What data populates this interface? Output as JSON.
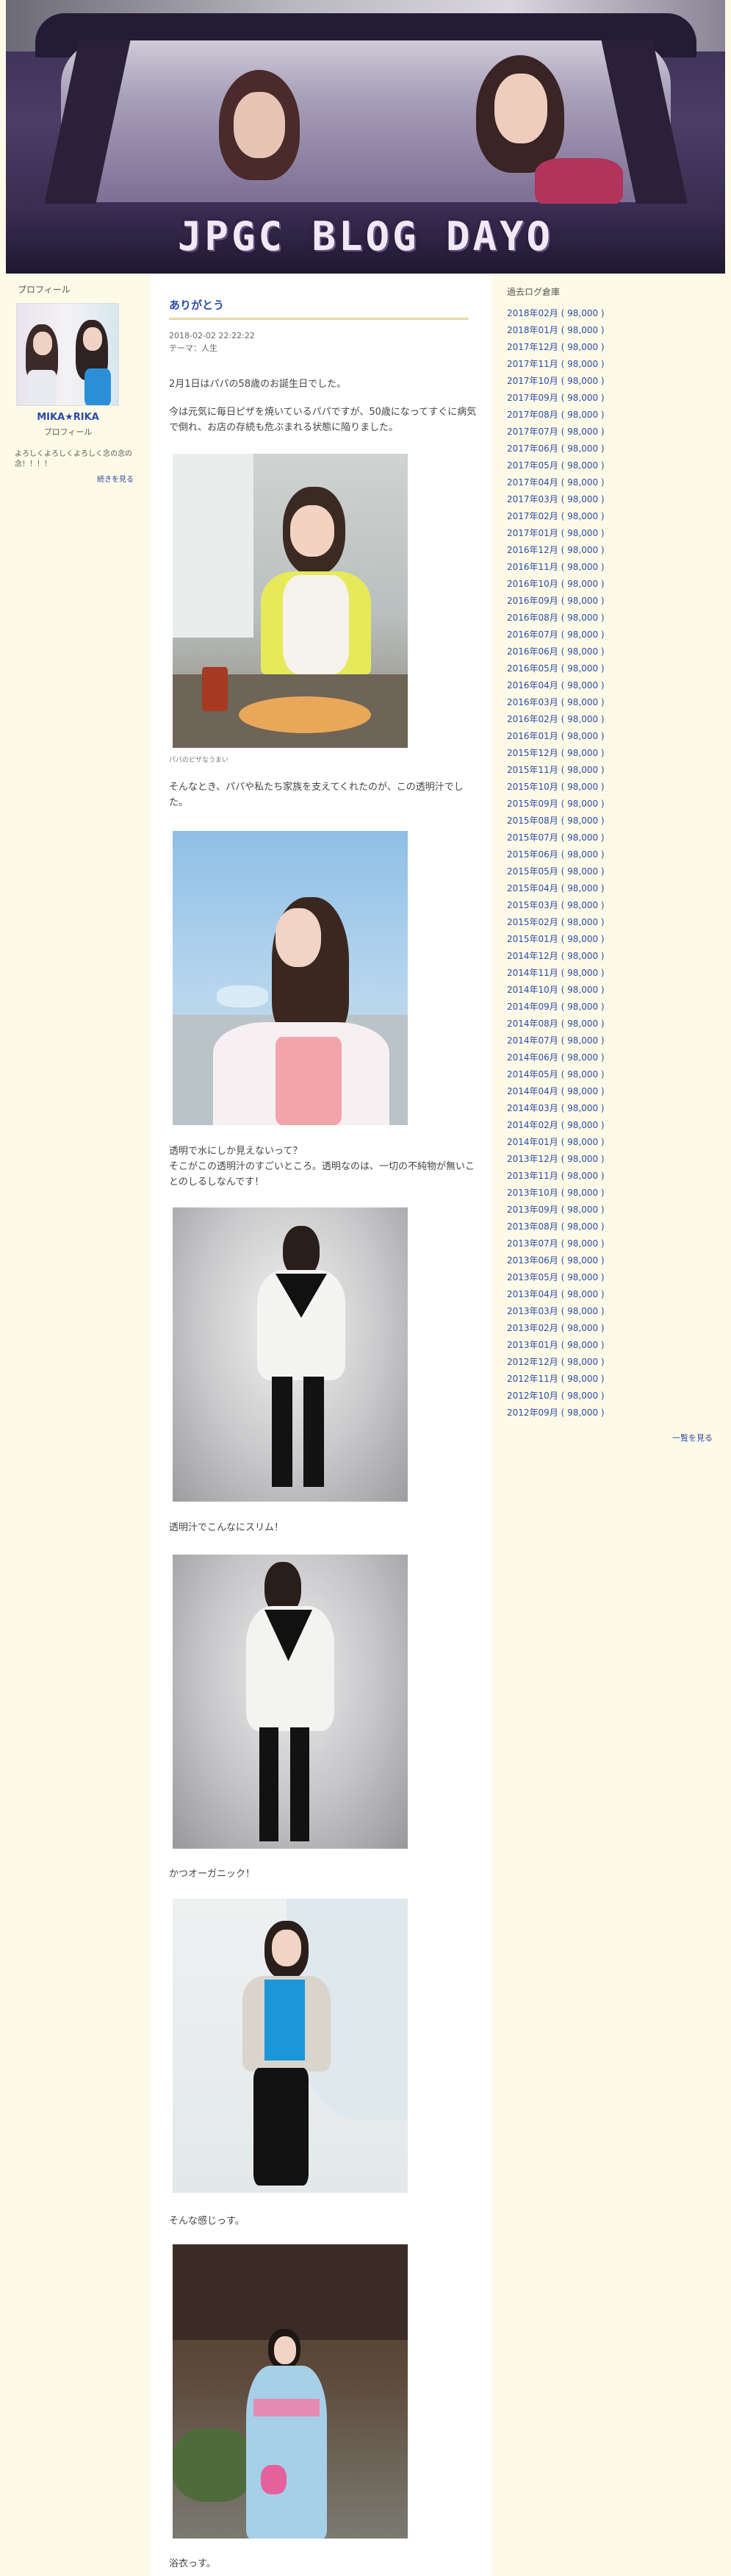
{
  "header": {
    "title": "JPGC BLOG DAYO"
  },
  "profile": {
    "heading": "プロフィール",
    "name": "MIKA★RIKA",
    "sub": "プロフィール",
    "description": "よろしくよろしくよろしく念の念の念！！！！",
    "more": "続きを見る"
  },
  "article": {
    "title": "ありがとう",
    "date": "2018-02-02 22:22:22",
    "theme": "テーマ：人生",
    "paragraphs": [
      "2月1日はパパの58歳のお誕生日でした。",
      "今は元気に毎日ピザを焼いているパパですが、50歳になってすぐに病気で倒れ、お店の存続も危ぶまれる状態に陥りました。",
      "パパのピザなうまい",
      "そんなとき、パパや私たち家族を支えてくれたのが、この透明汁でした。",
      "透明で水にしか見えないって？",
      "そこがこの透明汁のすごいところ。透明なのは、一切の不純物が無いことのしるしなんです！",
      "透明汁でこんなにスリム！",
      "かつオーガニック！",
      "そんな感じっす。",
      "浴衣っす。"
    ]
  },
  "archive": {
    "heading": "過去ログ倉庫",
    "items": [
      "2018年02月 ( 98,000 )",
      "2018年01月 ( 98,000 )",
      "2017年12月 ( 98,000 )",
      "2017年11月 ( 98,000 )",
      "2017年10月 ( 98,000 )",
      "2017年09月 ( 98,000 )",
      "2017年08月 ( 98,000 )",
      "2017年07月 ( 98,000 )",
      "2017年06月 ( 98,000 )",
      "2017年05月 ( 98,000 )",
      "2017年04月 ( 98,000 )",
      "2017年03月 ( 98,000 )",
      "2017年02月 ( 98,000 )",
      "2017年01月 ( 98,000 )",
      "2016年12月 ( 98,000 )",
      "2016年11月 ( 98,000 )",
      "2016年10月 ( 98,000 )",
      "2016年09月 ( 98,000 )",
      "2016年08月 ( 98,000 )",
      "2016年07月 ( 98,000 )",
      "2016年06月 ( 98,000 )",
      "2016年05月 ( 98,000 )",
      "2016年04月 ( 98,000 )",
      "2016年03月 ( 98,000 )",
      "2016年02月 ( 98,000 )",
      "2016年01月 ( 98,000 )",
      "2015年12月 ( 98,000 )",
      "2015年11月 ( 98,000 )",
      "2015年10月 ( 98,000 )",
      "2015年09月 ( 98,000 )",
      "2015年08月 ( 98,000 )",
      "2015年07月 ( 98,000 )",
      "2015年06月 ( 98,000 )",
      "2015年05月 ( 98,000 )",
      "2015年04月 ( 98,000 )",
      "2015年03月 ( 98,000 )",
      "2015年02月 ( 98,000 )",
      "2015年01月 ( 98,000 )",
      "2014年12月 ( 98,000 )",
      "2014年11月 ( 98,000 )",
      "2014年10月 ( 98,000 )",
      "2014年09月 ( 98,000 )",
      "2014年08月 ( 98,000 )",
      "2014年07月 ( 98,000 )",
      "2014年06月 ( 98,000 )",
      "2014年05月 ( 98,000 )",
      "2014年04月 ( 98,000 )",
      "2014年03月 ( 98,000 )",
      "2014年02月 ( 98,000 )",
      "2014年01月 ( 98,000 )",
      "2013年12月 ( 98,000 )",
      "2013年11月 ( 98,000 )",
      "2013年10月 ( 98,000 )",
      "2013年09月 ( 98,000 )",
      "2013年08月 ( 98,000 )",
      "2013年07月 ( 98,000 )",
      "2013年06月 ( 98,000 )",
      "2013年05月 ( 98,000 )",
      "2013年04月 ( 98,000 )",
      "2013年03月 ( 98,000 )",
      "2013年02月 ( 98,000 )",
      "2013年01月 ( 98,000 )",
      "2012年12月 ( 98,000 )",
      "2012年11月 ( 98,000 )",
      "2012年10月 ( 98,000 )",
      "2012年09月 ( 98,000 )"
    ],
    "more": "一覧を見る"
  }
}
